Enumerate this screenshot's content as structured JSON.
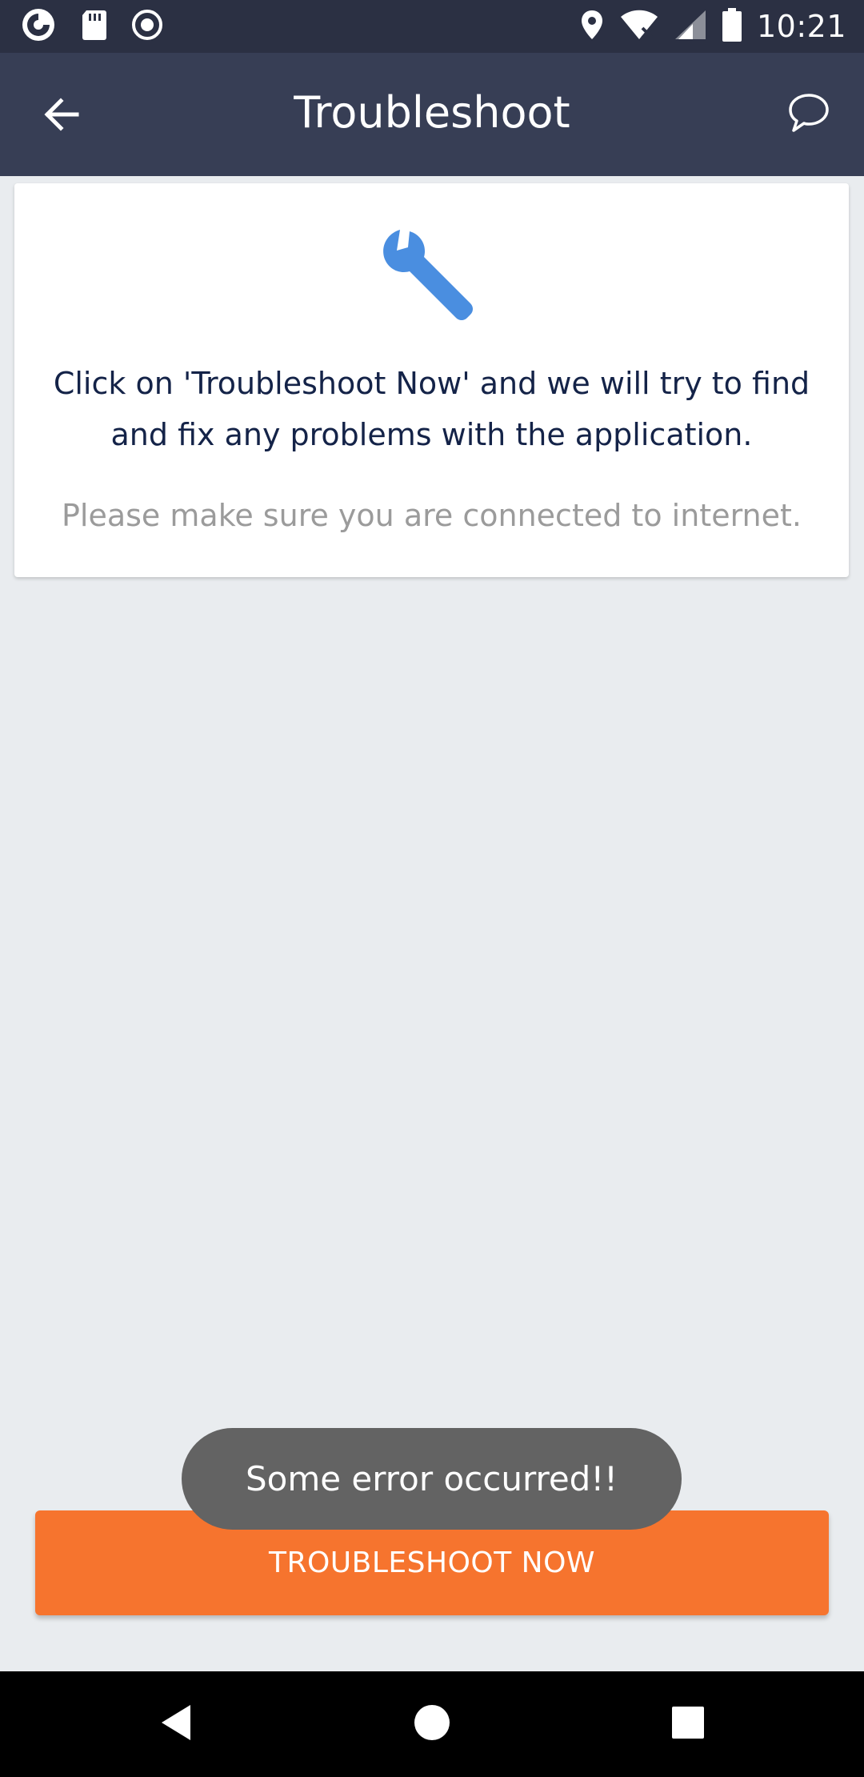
{
  "status_bar": {
    "time": "10:21",
    "left_icons": [
      "app-logo-icon",
      "sd-card-icon",
      "record-icon"
    ],
    "right_icons": [
      "location-icon",
      "wifi-icon",
      "signal-icon",
      "battery-icon"
    ]
  },
  "app_bar": {
    "title": "Troubleshoot",
    "back_icon": "arrow-left-icon",
    "chat_icon": "chat-bubble-icon"
  },
  "card": {
    "icon": "wrench-icon",
    "icon_color": "#4a8ee0",
    "message": "Click on 'Troubleshoot Now' and we will try to find and fix any problems with the application.",
    "note": "Please make sure you are connected to internet."
  },
  "toast": {
    "message": "Some error occurred!!"
  },
  "actions": {
    "troubleshoot_label": "TROUBLESHOOT NOW",
    "button_color": "#f6742e"
  },
  "nav_bar": {
    "items": [
      "back-triangle-icon",
      "home-circle-icon",
      "recents-square-icon"
    ]
  }
}
